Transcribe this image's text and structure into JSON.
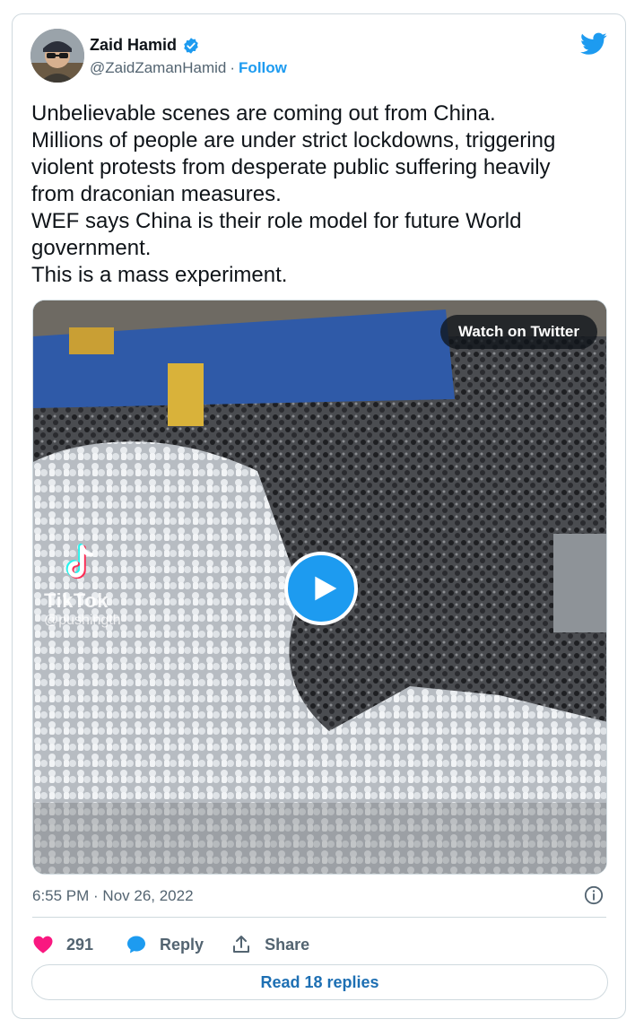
{
  "author": {
    "name": "Zaid Hamid",
    "handle": "@ZaidZamanHamid",
    "separator": "·",
    "follow_label": "Follow"
  },
  "tweet": {
    "lines": [
      "Unbelievable scenes are coming out from China.",
      "Millions of people are under strict lockdowns, triggering",
      "violent protests from desperate public suffering heavily",
      "from draconian measures.",
      "WEF says China is their role model for future World",
      "government.",
      "This is a mass experiment."
    ]
  },
  "media": {
    "watch_label": "Watch on Twitter",
    "watermark_brand": "TikTok",
    "watermark_user": "@pushingth"
  },
  "timestamp": "6:55 PM · Nov 26, 2022",
  "actions": {
    "like_count": "291",
    "reply_label": "Reply",
    "share_label": "Share"
  },
  "read_replies_label": "Read 18 replies",
  "colors": {
    "accent": "#1d9bf0",
    "like": "#f91880",
    "text_secondary": "#536471",
    "border": "#cfd9de"
  },
  "icons": [
    "verified-badge-icon",
    "twitter-logo-icon",
    "play-icon",
    "info-icon",
    "heart-icon",
    "reply-bubble-icon",
    "share-icon",
    "tiktok-icon"
  ]
}
